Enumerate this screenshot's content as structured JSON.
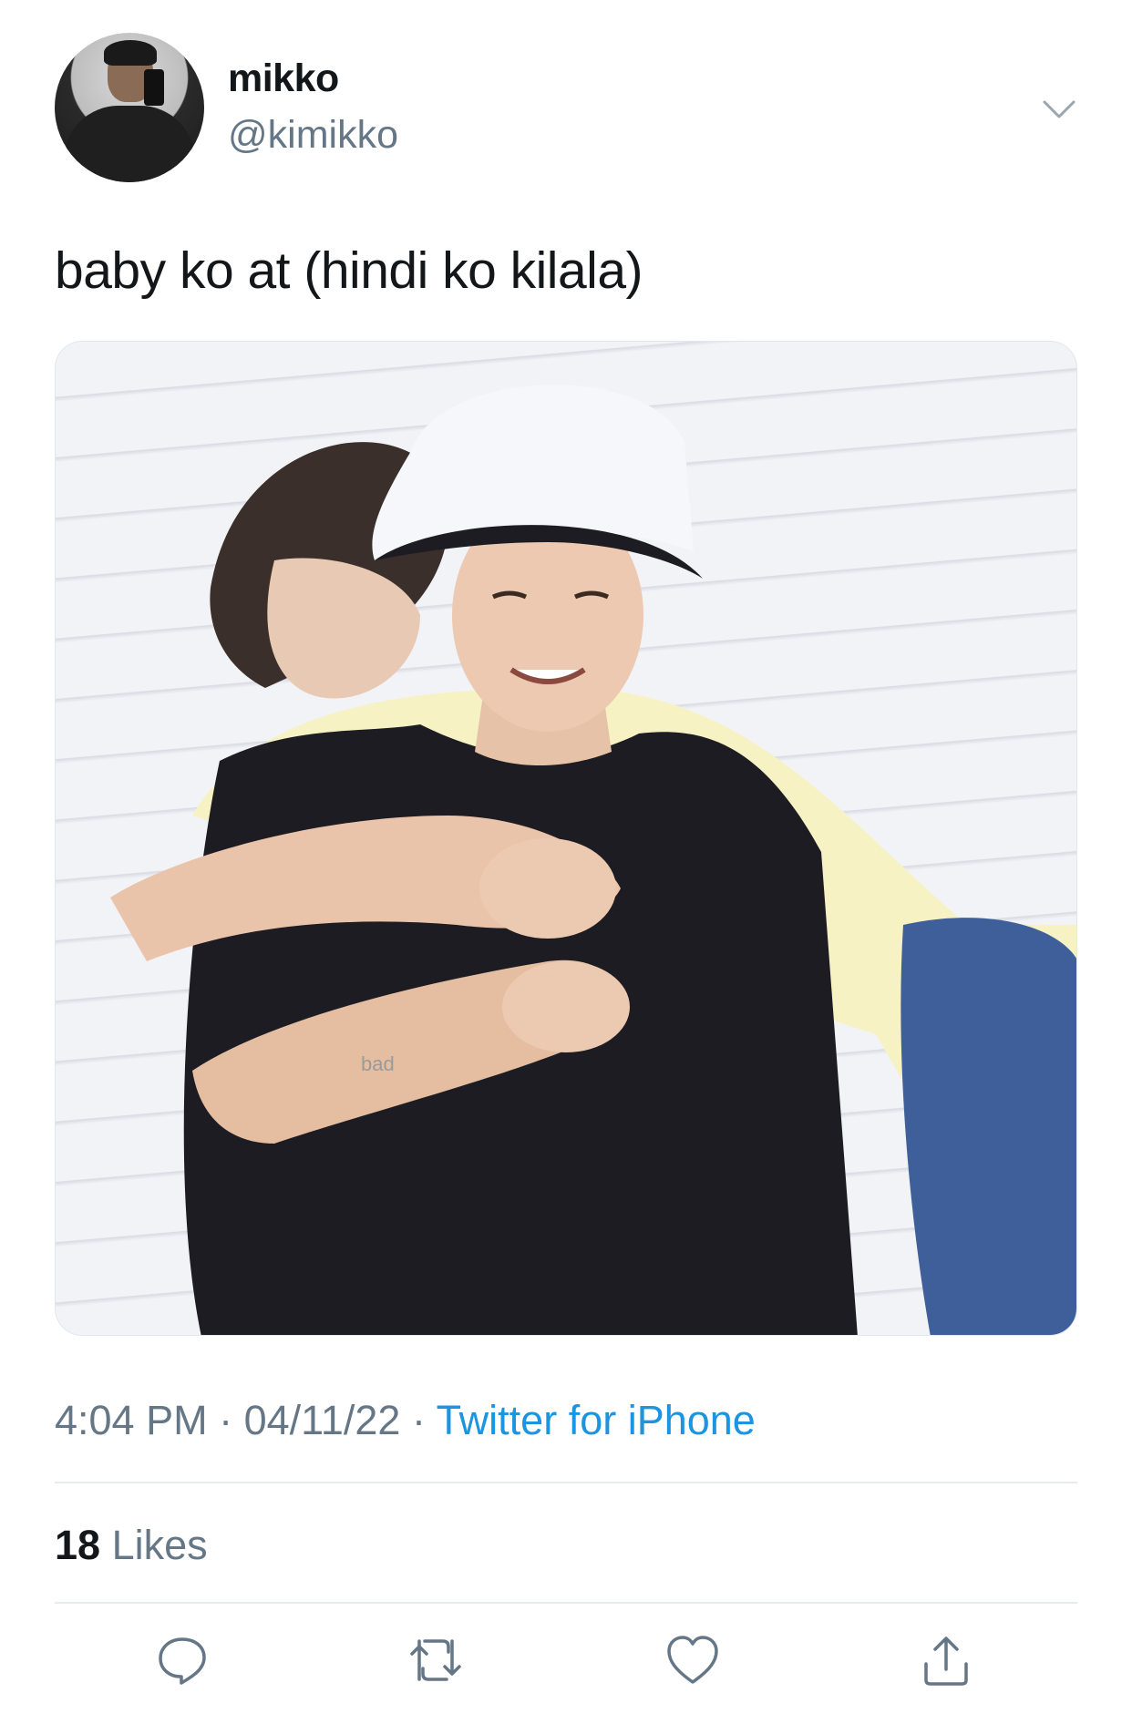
{
  "user": {
    "display_name": "mikko",
    "handle": "@kimikko"
  },
  "tweet": {
    "text": "baby ko at (hindi ko kilala)",
    "time": "4:04 PM",
    "separator": "·",
    "date": "04/11/22",
    "source": "Twitter for iPhone"
  },
  "stats": {
    "likes_count": "18",
    "likes_label": "Likes"
  },
  "icons": {
    "more": "chevron-down-icon",
    "reply": "reply-icon",
    "retweet": "retweet-icon",
    "like": "heart-icon",
    "share": "share-icon"
  },
  "colors": {
    "text": "#14171a",
    "secondary": "#657786",
    "link": "#1b95e0",
    "divider": "#e6ecf0"
  }
}
